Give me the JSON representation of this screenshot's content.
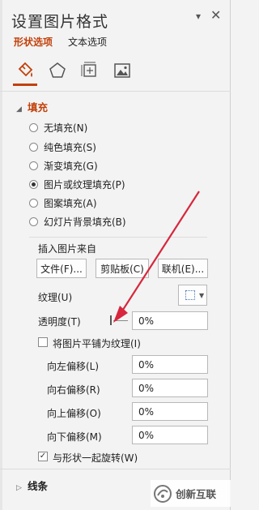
{
  "header": {
    "title": "设置图片格式",
    "pin_glyph": "▾",
    "close_glyph": "✕"
  },
  "tabs": [
    {
      "label": "形状选项",
      "active": true
    },
    {
      "label": "文本选项",
      "active": false
    }
  ],
  "category_icons": [
    "paint-bucket-icon",
    "pentagon-icon",
    "size-position-icon",
    "picture-icon"
  ],
  "colors": {
    "accent": "#c2410c",
    "annotation_arrow": "#d7263d"
  },
  "fill_section": {
    "title": "填充",
    "options": [
      {
        "label": "无填充(N)",
        "selected": false
      },
      {
        "label": "纯色填充(S)",
        "selected": false
      },
      {
        "label": "渐变填充(G)",
        "selected": false
      },
      {
        "label": "图片或纹理填充(P)",
        "selected": true
      },
      {
        "label": "图案填充(A)",
        "selected": false
      },
      {
        "label": "幻灯片背景填充(B)",
        "selected": false
      }
    ],
    "insert_from": "插入图片来自",
    "buttons": {
      "file": "文件(F)...",
      "clipboard": "剪贴板(C)",
      "online": "联机(E)..."
    },
    "texture_label": "纹理(U)",
    "transparency_label": "透明度(T)",
    "transparency_value": "0%",
    "tile_label": "将图片平铺为纹理(I)",
    "tile_checked": false,
    "offsets": [
      {
        "label": "向左偏移(L)",
        "value": "0%"
      },
      {
        "label": "向右偏移(R)",
        "value": "0%"
      },
      {
        "label": "向上偏移(O)",
        "value": "0%"
      },
      {
        "label": "向下偏移(M)",
        "value": "0%"
      }
    ],
    "rotate_label": "与形状一起旋转(W)",
    "rotate_checked": true
  },
  "line_section": {
    "title": "线条"
  },
  "watermark": {
    "text": "创新互联"
  }
}
